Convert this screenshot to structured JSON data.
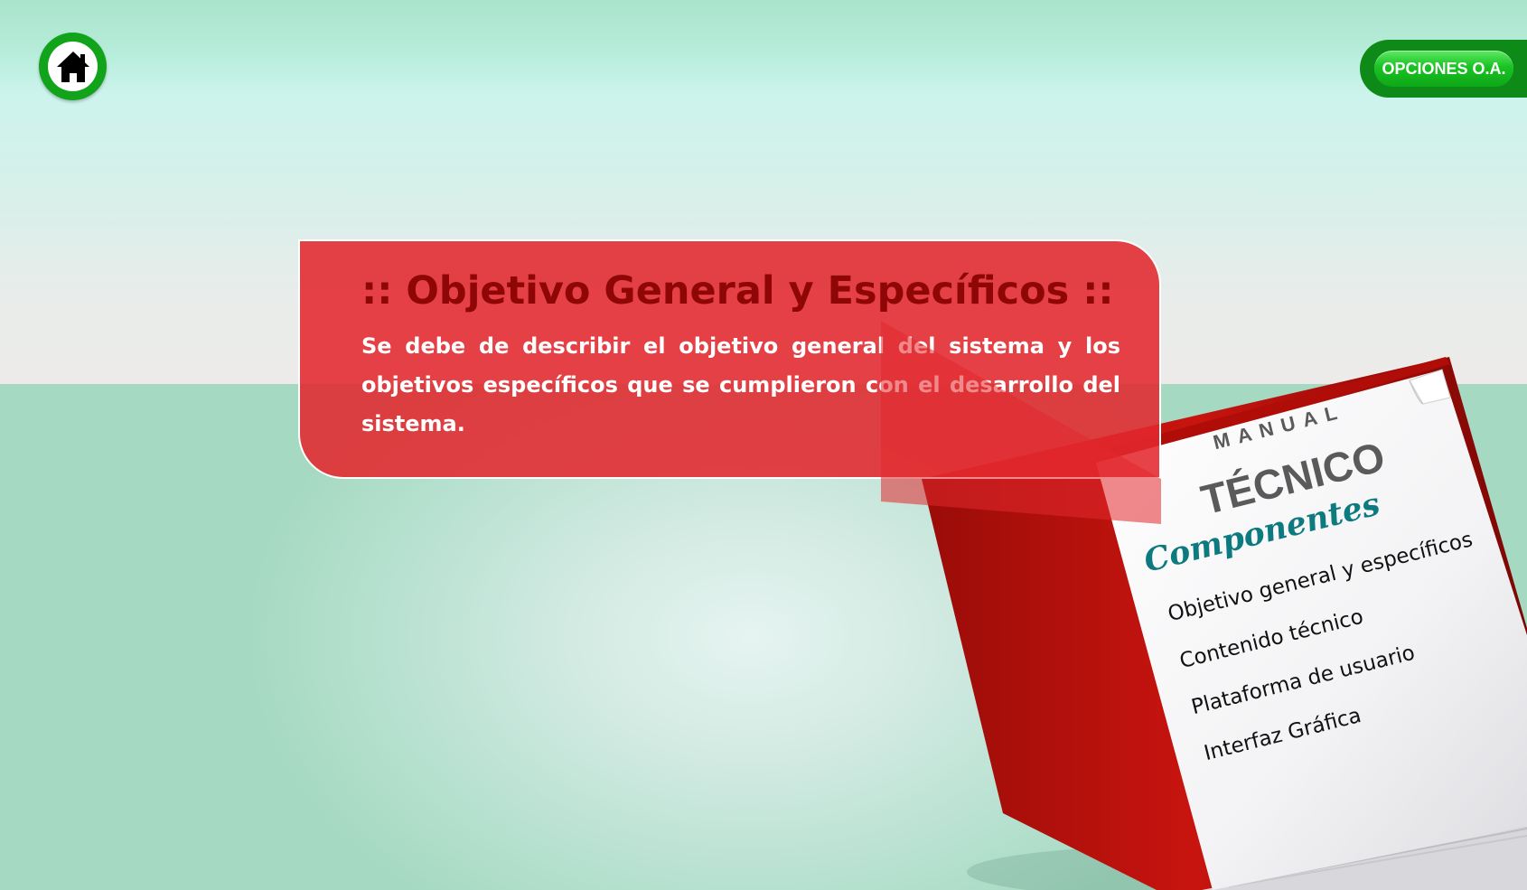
{
  "nav": {
    "home_icon": "home-icon",
    "options_label": "OPCIONES O.A."
  },
  "panel": {
    "title": ":: Objetivo General y Específicos ::",
    "body": "Se debe de describir el objetivo general del sistema y  los objetivos específicos que se cumplieron con el desarrollo del sistema."
  },
  "manual": {
    "label_small": "MANUAL",
    "label_big": "TÉCNICO",
    "components_heading": "Componentes",
    "items": [
      {
        "label": "Objetivo general y específicos"
      },
      {
        "label": "Contenido técnico"
      },
      {
        "label": "Plataforma de usuario"
      },
      {
        "label": "Interfaz Gráfica"
      }
    ]
  },
  "colors": {
    "accent_green": "#11a41a",
    "panel_red": "#e2282e",
    "title_red": "#8e0606",
    "book_red": "#c8140f",
    "components_teal": "#0d7a80"
  }
}
